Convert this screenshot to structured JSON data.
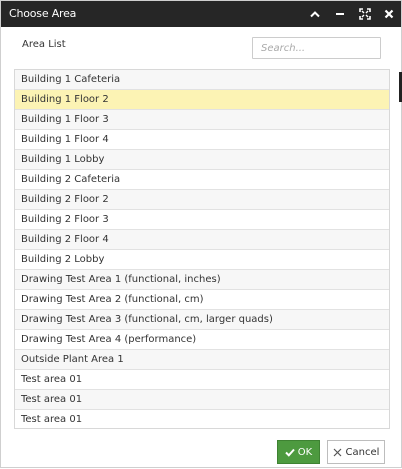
{
  "dialog": {
    "title": "Choose Area",
    "titlebar_icons": [
      "chevron-up-icon",
      "minimize-icon",
      "maximize-icon",
      "close-icon"
    ]
  },
  "header": {
    "label": "Area List",
    "search_placeholder": "Search..."
  },
  "areas": [
    "Building 1 Cafeteria",
    "Building 1 Floor 2",
    "Building 1 Floor 3",
    "Building 1 Floor 4",
    "Building 1 Lobby",
    "Building 2 Cafeteria",
    "Building 2 Floor 2",
    "Building 2 Floor 3",
    "Building 2 Floor 4",
    "Building 2 Lobby",
    "Drawing Test Area 1 (functional, inches)",
    "Drawing Test Area 2 (functional, cm)",
    "Drawing Test Area 3 (functional, cm, larger quads)",
    "Drawing Test Area 4 (performance)",
    "Outside Plant Area 1",
    "Test area 01",
    "Test area 01",
    "Test area 01"
  ],
  "selected_area": "Building 1 Floor 2",
  "footer": {
    "ok_label": "OK",
    "cancel_label": "Cancel"
  },
  "colors": {
    "titlebar": "#262626",
    "selected_row": "#fcf3b4",
    "ok_button": "#4d9a3f"
  }
}
